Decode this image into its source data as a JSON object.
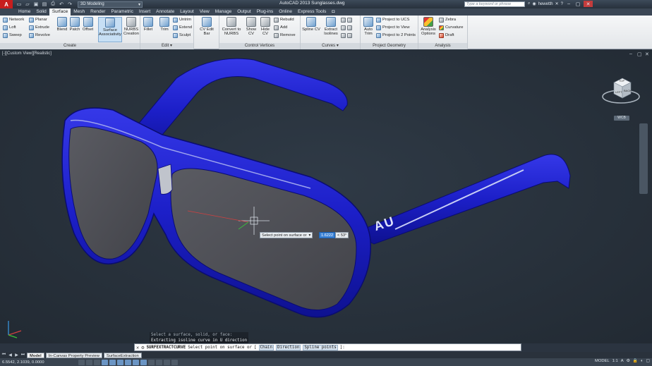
{
  "titlebar": {
    "app_logo": "A",
    "workspace": "3D Modeling",
    "title": "AutoCAD 2013   Sunglasses.dwg",
    "search_placeholder": "Type a keyword or phrase",
    "user": "hewetth",
    "qat_icons": [
      "new-icon",
      "open-icon",
      "save-icon",
      "saveas-icon",
      "print-icon",
      "undo-icon",
      "redo-icon"
    ]
  },
  "ribbon_tabs": [
    "Home",
    "Solid",
    "Surface",
    "Mesh",
    "Render",
    "Parametric",
    "Insert",
    "Annotate",
    "Layout",
    "View",
    "Manage",
    "Output",
    "Plug-ins",
    "Online",
    "Express Tools"
  ],
  "ribbon_active_tab": "Surface",
  "ribbon": {
    "create": {
      "title": "Create",
      "small": [
        "Network",
        "Loft",
        "Sweep",
        "Planar",
        "Extrude",
        "Revolve"
      ],
      "big": [
        "Blend",
        "Patch",
        "Offset",
        "Surface Associativity",
        "NURBS Creation"
      ]
    },
    "edit": {
      "title": "Edit",
      "big": [
        "Fillet",
        "Trim"
      ],
      "small": [
        "Untrim",
        "Extend",
        "Sculpt"
      ]
    },
    "cv_edit": {
      "big": [
        "CV Edit Bar"
      ]
    },
    "control_vertices": {
      "title": "Control Vertices",
      "big": [
        "Convert to NURBS",
        "Show CV",
        "Hide CV"
      ],
      "small": [
        "Rebuild",
        "Add",
        "Remove"
      ]
    },
    "curves": {
      "title": "Curves",
      "big": [
        "Spline CV",
        "Extract Isolines"
      ]
    },
    "project_geometry": {
      "title": "Project Geometry",
      "big": [
        "Auto Trim"
      ],
      "small": [
        "Project to UCS",
        "Project to View",
        "Project to 2 Points"
      ]
    },
    "analysis": {
      "title": "Analysis",
      "big": [
        "Analysis Options"
      ],
      "small": [
        "Zebra",
        "Curvature",
        "Draft"
      ]
    }
  },
  "viewport": {
    "label": "[-][Custom View][Realistic]",
    "model_text": "AU",
    "frame_color": "#1c1fc8",
    "lens_color": "#4a4b52",
    "wcs": "WCB",
    "viewcube_top": "TOP",
    "viewcube_left": "LEFT",
    "viewcube_back": "BACK",
    "tooltip_prompt": "Select point on surface or",
    "tooltip_value": "1.6222",
    "tooltip_angle": "< 53°"
  },
  "history": [
    "Select a surface, solid, or face:",
    "Extracting isoline curve in U direction"
  ],
  "command": {
    "name": "SURFEXTRACTCURVE",
    "prompt": "Select point on surface or",
    "options": [
      "Chain",
      "Direction",
      "Spline points"
    ],
    "suffix": "]:"
  },
  "layout_tabs": [
    "Model",
    "In-Canvas Property Preview",
    "SurfaceExtraction"
  ],
  "active_layout_tab": "Model",
  "status": {
    "coords": "6.5542, 2.1039, 0.0000",
    "model": "MODEL",
    "scale": "1:1",
    "zoom": "A"
  }
}
